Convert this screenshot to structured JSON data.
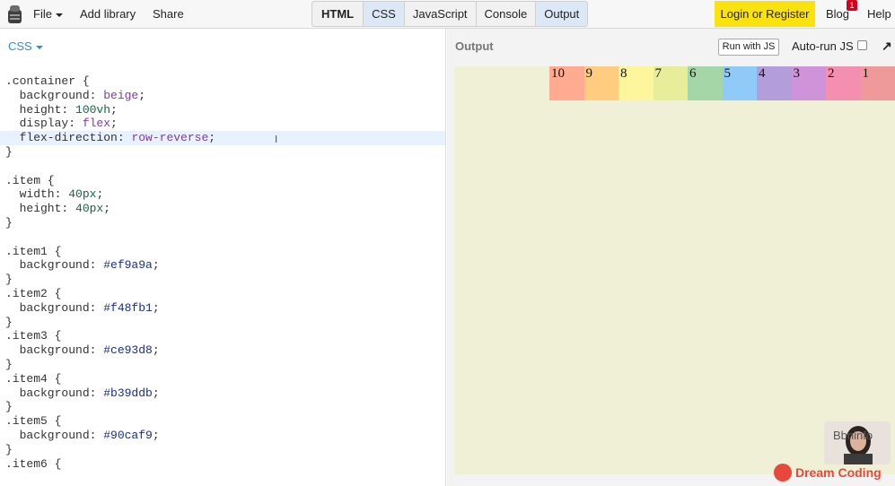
{
  "topbar": {
    "file_label": "File",
    "add_library_label": "Add library",
    "share_label": "Share",
    "tabs": [
      "HTML",
      "CSS",
      "JavaScript",
      "Console",
      "Output"
    ],
    "login_label": "Login or Register",
    "blog_label": "Blog",
    "blog_badge": "1",
    "help_label": "Help"
  },
  "editor": {
    "language_label": "CSS"
  },
  "output": {
    "title": "Output",
    "run_label": "Run with JS",
    "autorun_label": "Auto-run JS",
    "autorun_checked": false,
    "items": [
      {
        "label": "1",
        "color": "#ef9a9a"
      },
      {
        "label": "2",
        "color": "#f48fb1"
      },
      {
        "label": "3",
        "color": "#ce93d8"
      },
      {
        "label": "4",
        "color": "#b39ddb"
      },
      {
        "label": "5",
        "color": "#90caf9"
      },
      {
        "label": "6",
        "color": "#a5d6a7"
      },
      {
        "label": "7",
        "color": "#e6ee9c"
      },
      {
        "label": "8",
        "color": "#fff59d"
      },
      {
        "label": "9",
        "color": "#ffcc80"
      },
      {
        "label": "10",
        "color": "#ffab91"
      }
    ]
  },
  "watermark": {
    "avatar_text": "Bbninfo",
    "brand": "Dream Coding"
  },
  "colors": {
    "accent_blue": "#2b8fd8",
    "login_yellow": "#fae20f",
    "stage_beige": "#f0f0d7",
    "highlight_line": "#e8f2ff"
  }
}
